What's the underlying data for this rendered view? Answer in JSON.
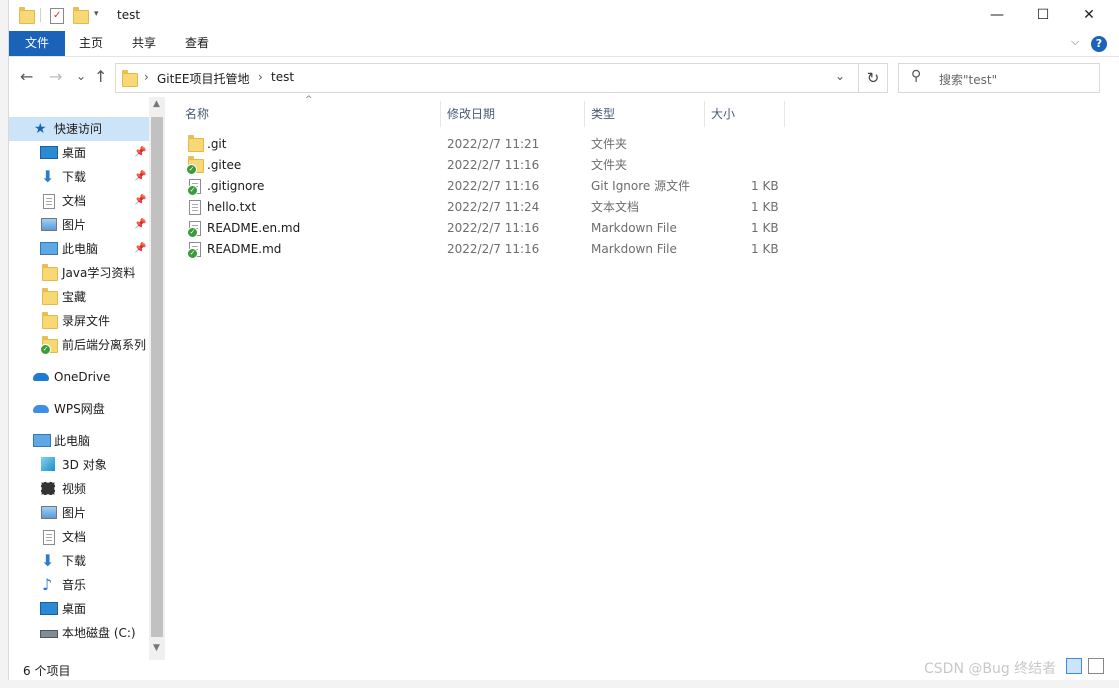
{
  "window": {
    "title": "test",
    "controls": {
      "minimize": "—",
      "maximize": "☐",
      "close": "✕"
    }
  },
  "ribbon": {
    "tabs": [
      {
        "label": "文件",
        "active": true
      },
      {
        "label": "主页"
      },
      {
        "label": "共享"
      },
      {
        "label": "查看"
      }
    ],
    "help": "?",
    "collapse": "⌵"
  },
  "nav": {
    "back": "←",
    "forward": "→",
    "recent": "⌄",
    "up": "↑",
    "breadcrumb": [
      "GitEE项目托管地",
      "test"
    ],
    "separator": "›",
    "dropdown": "⌄",
    "refresh": "↻",
    "search_placeholder": "搜索\"test\""
  },
  "sidebar": {
    "quick_access": "快速访问",
    "items": [
      {
        "label": "桌面",
        "icon": "desktop-icon",
        "pinned": true
      },
      {
        "label": "下载",
        "icon": "download-icon",
        "pinned": true
      },
      {
        "label": "文档",
        "icon": "document-icon",
        "pinned": true
      },
      {
        "label": "图片",
        "icon": "picture-icon",
        "pinned": true
      },
      {
        "label": "此电脑",
        "icon": "computer-icon",
        "pinned": true
      },
      {
        "label": "Java学习资料",
        "icon": "folder-icon"
      },
      {
        "label": "宝藏",
        "icon": "folder-icon"
      },
      {
        "label": "录屏文件",
        "icon": "folder-icon"
      },
      {
        "label": "前后端分离系列",
        "icon": "folder-synced-icon"
      }
    ],
    "onedrive": "OneDrive",
    "wps": "WPS网盘",
    "this_pc": "此电脑",
    "pc_items": [
      {
        "label": "3D 对象",
        "icon": "cube-icon"
      },
      {
        "label": "视频",
        "icon": "video-icon"
      },
      {
        "label": "图片",
        "icon": "picture-icon"
      },
      {
        "label": "文档",
        "icon": "document-icon"
      },
      {
        "label": "下载",
        "icon": "download-icon"
      },
      {
        "label": "音乐",
        "icon": "music-icon"
      },
      {
        "label": "桌面",
        "icon": "desktop-icon"
      },
      {
        "label": "本地磁盘 (C:)",
        "icon": "drive-icon"
      }
    ],
    "pin_glyph": "📌"
  },
  "columns": {
    "name": "名称",
    "date": "修改日期",
    "type": "类型",
    "size": "大小",
    "sort_indicator": "^"
  },
  "files": [
    {
      "name": ".git",
      "date": "2022/2/7 11:21",
      "type": "文件夹",
      "size": "",
      "icon": "folder-icon"
    },
    {
      "name": ".gitee",
      "date": "2022/2/7 11:16",
      "type": "文件夹",
      "size": "",
      "icon": "folder-synced-icon"
    },
    {
      "name": ".gitignore",
      "date": "2022/2/7 11:16",
      "type": "Git Ignore 源文件",
      "size": "1 KB",
      "icon": "file-synced-icon"
    },
    {
      "name": "hello.txt",
      "date": "2022/2/7 11:24",
      "type": "文本文档",
      "size": "1 KB",
      "icon": "text-file-icon"
    },
    {
      "name": "README.en.md",
      "date": "2022/2/7 11:16",
      "type": "Markdown File",
      "size": "1 KB",
      "icon": "file-synced-icon"
    },
    {
      "name": "README.md",
      "date": "2022/2/7 11:16",
      "type": "Markdown File",
      "size": "1 KB",
      "icon": "file-synced-icon"
    }
  ],
  "status": {
    "count": "6 个项目"
  },
  "watermark": "CSDN @Bug 终结者",
  "colors": {
    "accent": "#1a63b8",
    "selection": "#cce4f7",
    "folder": "#f8d775",
    "synced": "#3a9b3a"
  }
}
